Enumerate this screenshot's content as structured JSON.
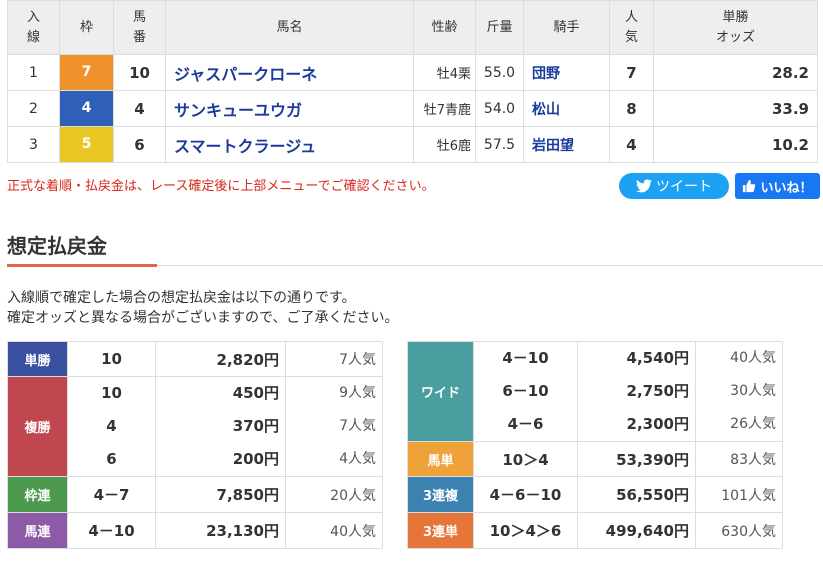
{
  "headers": {
    "arrival": "入\n線",
    "waku": "枠",
    "umaban": "馬\n番",
    "name": "馬名",
    "sex": "性齢",
    "weight": "斤量",
    "jockey": "騎手",
    "pop": "人\n気",
    "odds": "単勝\nオッズ"
  },
  "rows": [
    {
      "arrival": "1",
      "waku": "7",
      "waku_color": "#f0922c",
      "umaban": "10",
      "name": "ジャスパークローネ",
      "sex": "牡4栗",
      "weight": "55.0",
      "jockey": "団野",
      "pop": "7",
      "odds": "28.2"
    },
    {
      "arrival": "2",
      "waku": "4",
      "waku_color": "#2f5fb8",
      "umaban": "4",
      "name": "サンキューユウガ",
      "sex": "牡7青鹿",
      "weight": "54.0",
      "jockey": "松山",
      "pop": "8",
      "odds": "33.9"
    },
    {
      "arrival": "3",
      "waku": "5",
      "waku_color": "#e8c623",
      "umaban": "6",
      "name": "スマートクラージュ",
      "sex": "牡6鹿",
      "weight": "57.5",
      "jockey": "岩田望",
      "pop": "4",
      "odds": "10.2"
    }
  ],
  "notice": "正式な着順・払戻金は、レース確定後に上部メニューでご確認ください。",
  "tweet_label": "ツイート",
  "like_label": "いいね！",
  "section_title": "想定払戻金",
  "desc_line1": "入線順で確定した場合の想定払戻金は以下の通りです。",
  "desc_line2": "確定オッズと異なる場合がございますので、ご了承ください。",
  "left_pay": {
    "tansho": {
      "label": "単勝",
      "color": "#3b4fa0",
      "combo": "10",
      "yen": "2,820円",
      "pop": "7人気"
    },
    "fukusho": {
      "label": "複勝",
      "color": "#c0474f",
      "items": [
        {
          "combo": "10",
          "yen": "450円",
          "pop": "9人気"
        },
        {
          "combo": "4",
          "yen": "370円",
          "pop": "7人気"
        },
        {
          "combo": "6",
          "yen": "200円",
          "pop": "4人気"
        }
      ]
    },
    "wakuren": {
      "label": "枠連",
      "color": "#4d9a4f",
      "combo": "4－7",
      "yen": "7,850円",
      "pop": "20人気"
    },
    "umaren": {
      "label": "馬連",
      "color": "#8c5aa6",
      "combo": "4－10",
      "yen": "23,130円",
      "pop": "40人気"
    }
  },
  "right_pay": {
    "wide": {
      "label": "ワイド",
      "color": "#4b9ea0",
      "items": [
        {
          "combo": "4－10",
          "yen": "4,540円",
          "pop": "40人気"
        },
        {
          "combo": "6－10",
          "yen": "2,750円",
          "pop": "30人気"
        },
        {
          "combo": "4－6",
          "yen": "2,300円",
          "pop": "26人気"
        }
      ]
    },
    "umatan": {
      "label": "馬単",
      "color": "#f0a23a",
      "combo": "10＞4",
      "yen": "53,390円",
      "pop": "83人気"
    },
    "sanrenpuku": {
      "label": "3連複",
      "color": "#3b82b0",
      "combo": "4－6－10",
      "yen": "56,550円",
      "pop": "101人気"
    },
    "sanrentan": {
      "label": "3連単",
      "color": "#e6753a",
      "combo": "10＞4＞6",
      "yen": "499,640円",
      "pop": "630人気"
    }
  }
}
